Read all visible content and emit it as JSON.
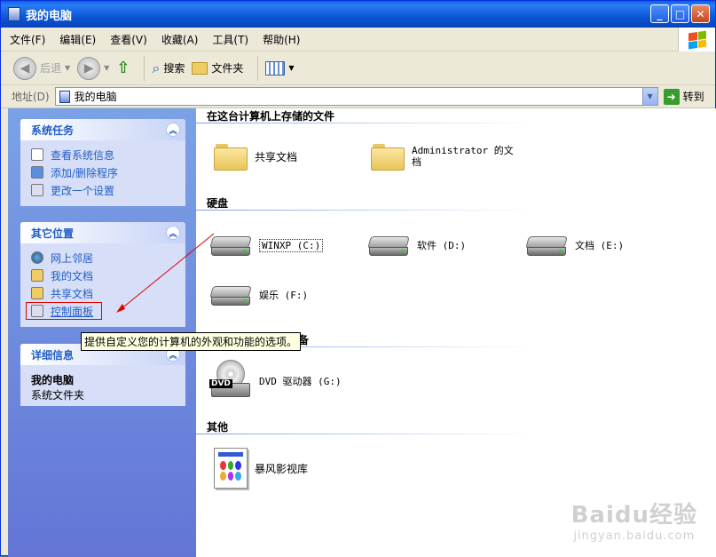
{
  "window": {
    "title": "我的电脑"
  },
  "menu": [
    "文件(F)",
    "编辑(E)",
    "查看(V)",
    "收藏(A)",
    "工具(T)",
    "帮助(H)"
  ],
  "toolbar": {
    "back": "后退",
    "search": "搜索",
    "folders": "文件夹"
  },
  "address": {
    "label": "地址(D)",
    "value": "我的电脑",
    "go": "转到"
  },
  "left_panels": {
    "system_tasks": {
      "title": "系统任务",
      "items": [
        "查看系统信息",
        "添加/删除程序",
        "更改一个设置"
      ]
    },
    "other_places": {
      "title": "其它位置",
      "items": [
        "网上邻居",
        "我的文档",
        "共享文档",
        "控制面板"
      ]
    },
    "details": {
      "title": "详细信息",
      "name": "我的电脑",
      "type": "系统文件夹"
    }
  },
  "sections": {
    "stored_files": {
      "title": "在这台计算机上存储的文件",
      "items": [
        "共享文档",
        "Administrator 的文档"
      ]
    },
    "hard_drives": {
      "title": "硬盘",
      "items": [
        "WINXP (C:)",
        "软件 (D:)",
        "文档 (E:)",
        "娱乐 (F:)"
      ]
    },
    "removable": {
      "title_visible_part": "备",
      "items": [
        "DVD 驱动器 (G:)"
      ]
    },
    "other": {
      "title": "其他",
      "items": [
        "暴风影视库"
      ]
    }
  },
  "tooltip": "提供自定义您的计算机的外观和功能的选项。",
  "watermark": {
    "main": "Baidu经验",
    "sub": "jingyan.baidu.com"
  },
  "colors": {
    "titlebar": "#0a5fe8",
    "task_link": "#215dc6",
    "left_pane": "#7ba2e7",
    "annotation": "#dd0000"
  }
}
